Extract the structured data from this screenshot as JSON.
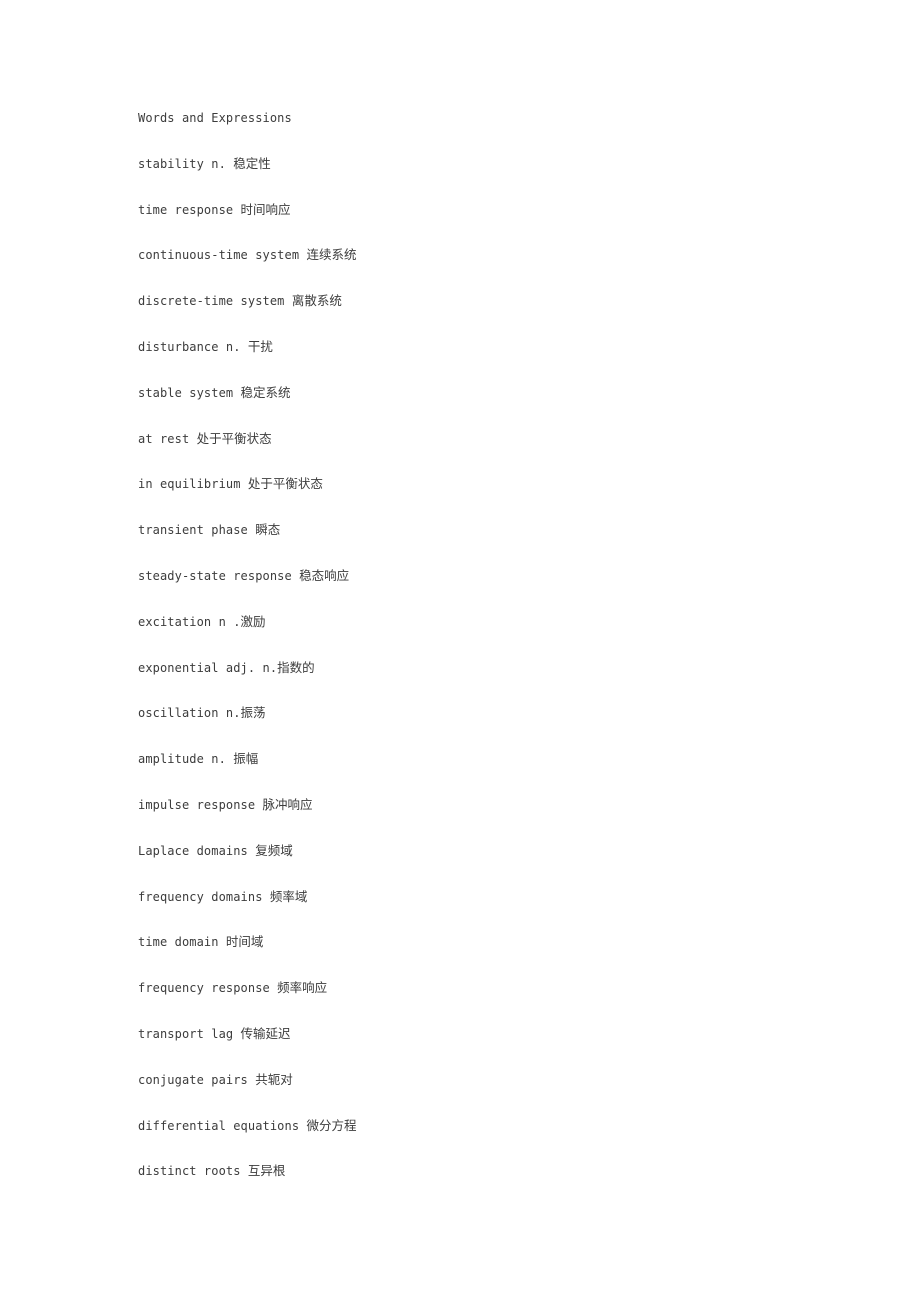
{
  "document": {
    "title": "Words and Expressions",
    "background_color": "#ffffff",
    "text_color": "#3c3c3c",
    "heading": "Words and Expressions",
    "entries": [
      {
        "term": "stability n. ",
        "gloss": "稳定性"
      },
      {
        "term": "time response ",
        "gloss": "时间响应"
      },
      {
        "term": "continuous-time system ",
        "gloss": "连续系统"
      },
      {
        "term": "discrete-time system ",
        "gloss": "离散系统"
      },
      {
        "term": "disturbance n. ",
        "gloss": "干扰"
      },
      {
        "term": "stable system ",
        "gloss": "稳定系统"
      },
      {
        "term": "at rest ",
        "gloss": "处于平衡状态"
      },
      {
        "term": "in equilibrium ",
        "gloss": "处于平衡状态"
      },
      {
        "term": "transient phase ",
        "gloss": "瞬态"
      },
      {
        "term": "steady-state response ",
        "gloss": "稳态响应"
      },
      {
        "term": "excitation n .",
        "gloss": "激励"
      },
      {
        "term": "exponential adj. n.",
        "gloss": "指数的"
      },
      {
        "term": "oscillation n.",
        "gloss": "振荡"
      },
      {
        "term": "amplitude n. ",
        "gloss": "振幅"
      },
      {
        "term": "impulse response ",
        "gloss": "脉冲响应"
      },
      {
        "term": "Laplace domains ",
        "gloss": "复频域"
      },
      {
        "term": "frequency domains ",
        "gloss": "频率域"
      },
      {
        "term": "time domain ",
        "gloss": "时间域"
      },
      {
        "term": "frequency response ",
        "gloss": "频率响应"
      },
      {
        "term": "transport lag ",
        "gloss": "传输延迟"
      },
      {
        "term": "conjugate pairs ",
        "gloss": "共轭对"
      },
      {
        "term": "differential equations ",
        "gloss": "微分方程"
      },
      {
        "term": "distinct roots ",
        "gloss": "互异根"
      }
    ]
  }
}
